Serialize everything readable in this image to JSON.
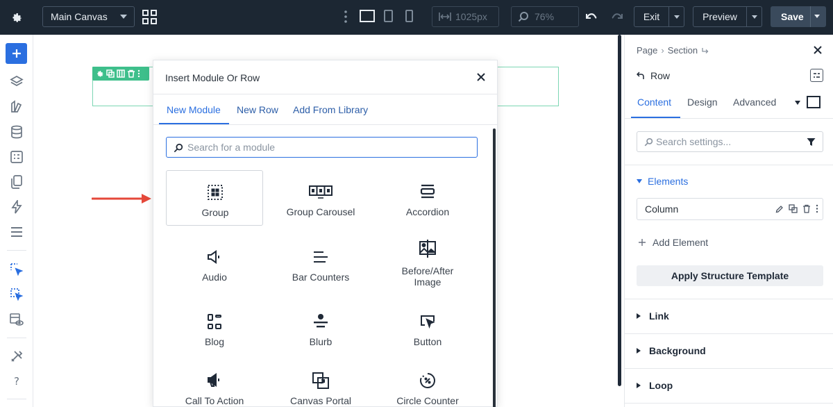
{
  "topbar": {
    "canvas_select": "Main Canvas",
    "width_value": "1025px",
    "zoom_value": "76%",
    "exit_label": "Exit",
    "preview_label": "Preview",
    "save_label": "Save"
  },
  "modal": {
    "title": "Insert Module Or Row",
    "tabs": [
      {
        "label": "New Module",
        "active": true
      },
      {
        "label": "New Row",
        "active": false
      },
      {
        "label": "Add From Library",
        "active": false
      }
    ],
    "search_placeholder": "Search for a module",
    "modules": [
      {
        "label": "Group",
        "icon": "group-icon",
        "selected": true
      },
      {
        "label": "Group Carousel",
        "icon": "group-carousel-icon"
      },
      {
        "label": "Accordion",
        "icon": "accordion-icon"
      },
      {
        "label": "Audio",
        "icon": "audio-icon"
      },
      {
        "label": "Bar Counters",
        "icon": "bar-counters-icon"
      },
      {
        "label": "Before/After Image",
        "label_line1": "Before/After",
        "label_line2": "Image",
        "icon": "before-after-icon"
      },
      {
        "label": "Blog",
        "icon": "blog-icon"
      },
      {
        "label": "Blurb",
        "icon": "blurb-icon"
      },
      {
        "label": "Button",
        "icon": "button-icon"
      },
      {
        "label": "Call To Action",
        "icon": "call-to-action-icon"
      },
      {
        "label": "Canvas Portal",
        "icon": "canvas-portal-icon"
      },
      {
        "label": "Circle Counter",
        "icon": "circle-counter-icon"
      }
    ]
  },
  "right_panel": {
    "breadcrumb": [
      "Page",
      "Section"
    ],
    "element_title": "Row",
    "tabs": [
      {
        "label": "Content",
        "active": true
      },
      {
        "label": "Design",
        "active": false
      },
      {
        "label": "Advanced",
        "active": false
      }
    ],
    "search_placeholder": "Search settings...",
    "elements_heading": "Elements",
    "column_label": "Column",
    "add_element_label": "Add Element",
    "apply_template_label": "Apply Structure Template",
    "sections": [
      "Link",
      "Background",
      "Loop"
    ]
  },
  "colors": {
    "topbar_bg": "#1c2733",
    "accent": "#2b6fe0",
    "row_toolbar": "#3ebf8b",
    "arrow": "#e5483a"
  }
}
